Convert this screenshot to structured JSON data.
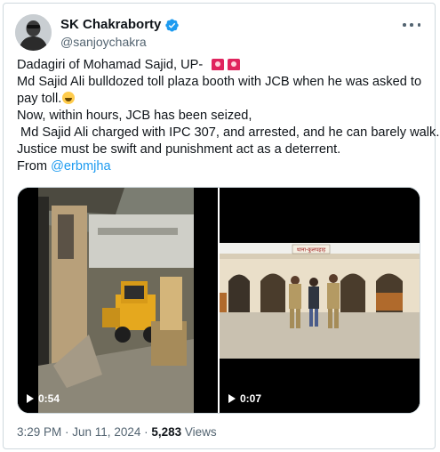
{
  "author": {
    "display_name": "SK Chakraborty",
    "handle": "@sanjoychakra"
  },
  "tweet": {
    "lines": [
      "Dadagiri of Mohamad Sajid, UP-",
      "Md Sajid Ali bulldozed toll plaza booth with JCB when he was asked to",
      "pay toll.",
      "Now, within hours, JCB has been seized,",
      " Md Sajid Ali charged with IPC 307, and arrested, and he can barely walk.",
      "Justice must be swift and punishment act as a deterrent.",
      "From "
    ],
    "mention": "@erbmjha"
  },
  "media": {
    "videos": [
      {
        "duration": "0:54"
      },
      {
        "duration": "0:07"
      }
    ],
    "sign_text": "थाना-कुलपहाड़"
  },
  "footer": {
    "time": "3:29 PM",
    "sep1": " · ",
    "date": "Jun 11, 2024",
    "sep2": " · ",
    "views_count": "5,283",
    "views_label": " Views"
  },
  "colors": {
    "verified": "#1d9bf0",
    "link": "#1d9bf0",
    "muted": "#536471",
    "alarm": "#e0245e"
  },
  "icons": [
    "verified-badge-icon",
    "more-options-icon",
    "police-light-emoji-icon",
    "laughing-emoji-icon",
    "play-icon"
  ]
}
